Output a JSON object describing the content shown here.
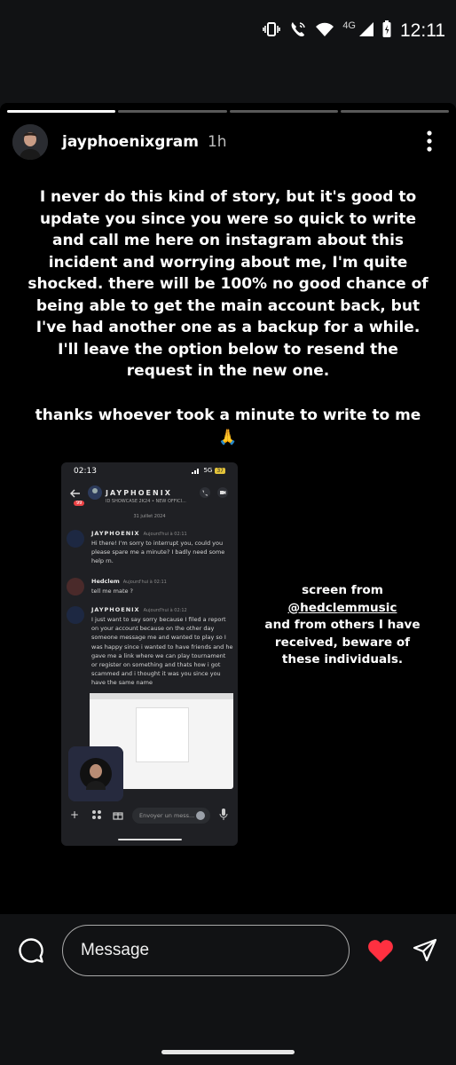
{
  "status_bar": {
    "time": "12:11",
    "network": "4G"
  },
  "story": {
    "progress_segments": 4,
    "current_segment": 1,
    "username": "jayphoenixgram",
    "age": "1h",
    "text_main": "I never do this kind of story, but it's good to update you since you were so quick to write and call me here on instagram about this incident and worrying about me, I'm quite shocked. there will be 100% no good chance of being able to get the main account back, but I've had another one as a backup for a while. I'll leave the option below to resend the request in the new one.",
    "text_thanks": "thanks whoever took a minute to write to me🙏",
    "side_line1": "screen from",
    "side_mention": "@hedclemmusic",
    "side_rest": "and from others I have received, beware of these individuals."
  },
  "screenshot": {
    "time": "02:13",
    "network": "5G",
    "battery": "37",
    "chat_name": "JAYPHOENIX",
    "chat_sub": "ID SHOWCASE 2K24 • NEW OFFICI...",
    "badge": "99",
    "date": "31 juillet 2024",
    "messages": [
      {
        "author": "JAYPHOENIX",
        "when": "Aujourd'hui à 02:11",
        "body": "Hi there! I'm sorry to interrupt you, could you please spare me a minute? I badly need some help rn."
      },
      {
        "author": "Hedclem",
        "when": "Aujourd'hui à 02:11",
        "body": "tell me mate ?"
      },
      {
        "author": "JAYPHOENIX",
        "when": "Aujourd'hui à 02:12",
        "body": "I just want to say sorry because I filed a report on your account because on the other day someone message me and wanted to play so I was happy since i wanted to have friends and he gave me a link where we can play tournament or register on something and thats how i got scammed and i thought it was you since you have the same name"
      }
    ],
    "input_placeholder": "Envoyer un mess..."
  },
  "reply": {
    "placeholder": "Message"
  }
}
